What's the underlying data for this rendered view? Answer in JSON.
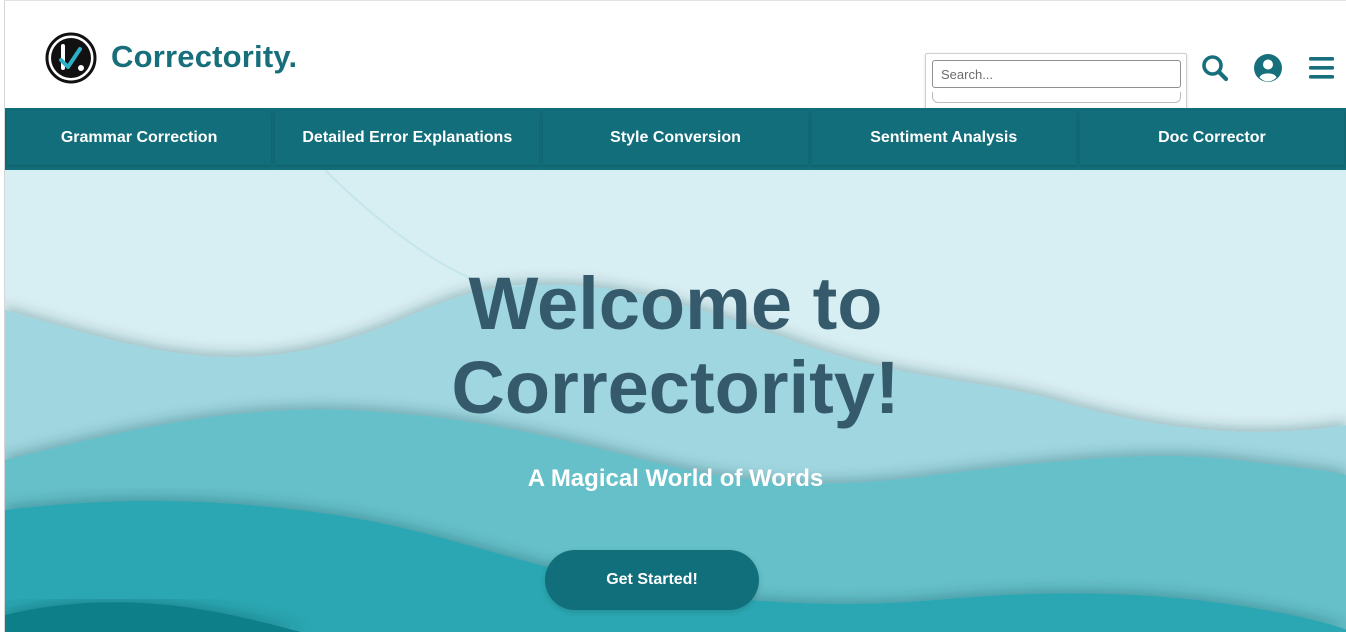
{
  "brand": {
    "name": "Correctority.",
    "color": "#176f7b"
  },
  "search": {
    "placeholder": "Search...",
    "value": ""
  },
  "header_icons": [
    "search-icon",
    "user-circle-icon",
    "hamburger-menu-icon"
  ],
  "nav": {
    "items": [
      {
        "label": "Grammar Correction"
      },
      {
        "label": "Detailed Error Explanations"
      },
      {
        "label": "Style Conversion"
      },
      {
        "label": "Sentiment Analysis"
      },
      {
        "label": "Doc Corrector"
      }
    ],
    "background": "#126e7a"
  },
  "hero": {
    "title_line1": "Welcome to",
    "title_line2": "Correctority!",
    "subtitle": "A Magical World of Words",
    "cta_label": "Get Started!",
    "title_color": "#345a6c"
  }
}
